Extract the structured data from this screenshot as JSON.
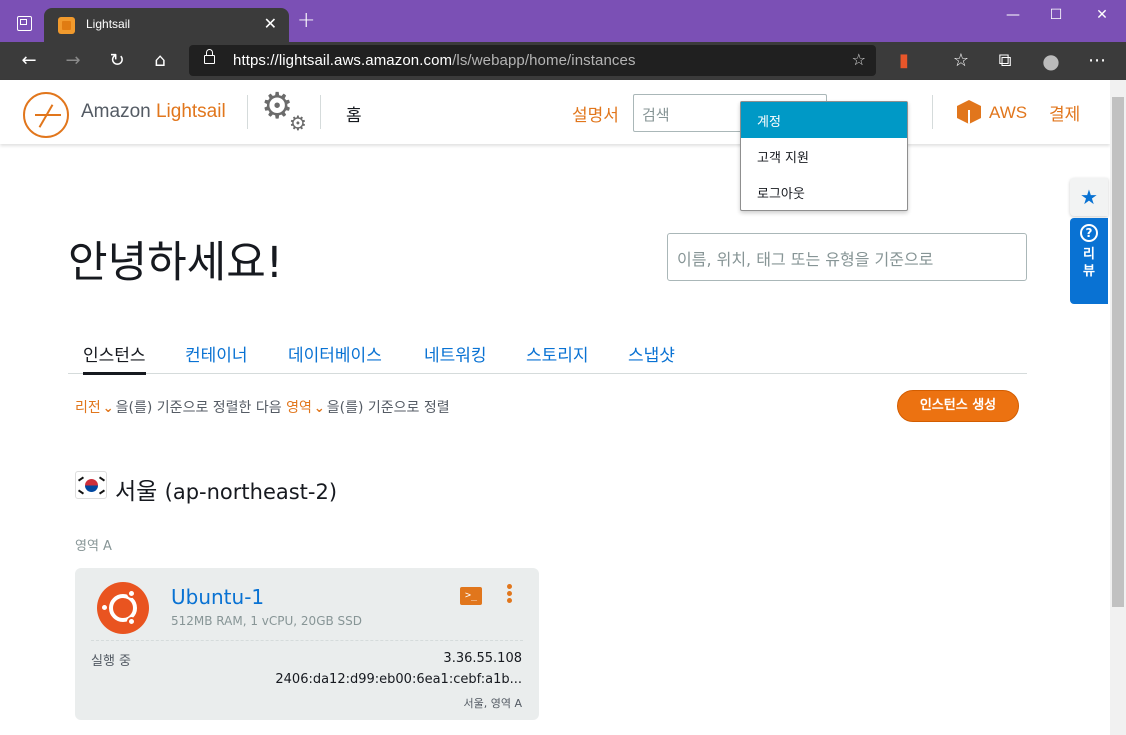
{
  "browser": {
    "tab_title": "Lightsail",
    "tab_close": "✕",
    "new_tab": "+",
    "url_host": "https://lightsail.aws.amazon.com",
    "url_path": "/ls/webapp/home/instances"
  },
  "header": {
    "brand_prefix": "Amazon",
    "brand_name": "Lightsail",
    "home": "홈",
    "docs": "설명서",
    "search_placeholder": "검색",
    "aws": "AWS",
    "billing": "결제"
  },
  "account_menu": {
    "items": [
      "계정",
      "고객 지원",
      "로그아웃"
    ]
  },
  "side": {
    "help_label": "리뷰"
  },
  "main": {
    "greeting": "안녕하세요!",
    "filter_placeholder": "이름, 위치, 태그 또는 유형을 기준으로",
    "tabs": [
      "인스턴스",
      "컨테이너",
      "데이터베이스",
      "네트워킹",
      "스토리지",
      "스냅샷"
    ],
    "sort": {
      "field1": "리전",
      "text1": "을(를) 기준으로 정렬한 다음",
      "field2": "영역",
      "text2": "을(를) 기준으로 정렬"
    },
    "create_button": "인스턴스 생성",
    "region_name": "서울",
    "region_code": "(ap-northeast-2)",
    "zone_label": "영역 A"
  },
  "instance": {
    "name": "Ubuntu-1",
    "spec": "512MB RAM, 1 vCPU, 20GB SSD",
    "state": "실행 중",
    "ipv4": "3.36.55.108",
    "ipv6": "2406:da12:d99:eb00:6ea1:cebf:a1b...",
    "location": "서울, 영역 A",
    "ssh_glyph": ">_"
  },
  "colors": {
    "accent": "#e1761c",
    "link": "#0972d3",
    "menu_highlight": "#0099c6",
    "browser_frame": "#7b50b5"
  }
}
